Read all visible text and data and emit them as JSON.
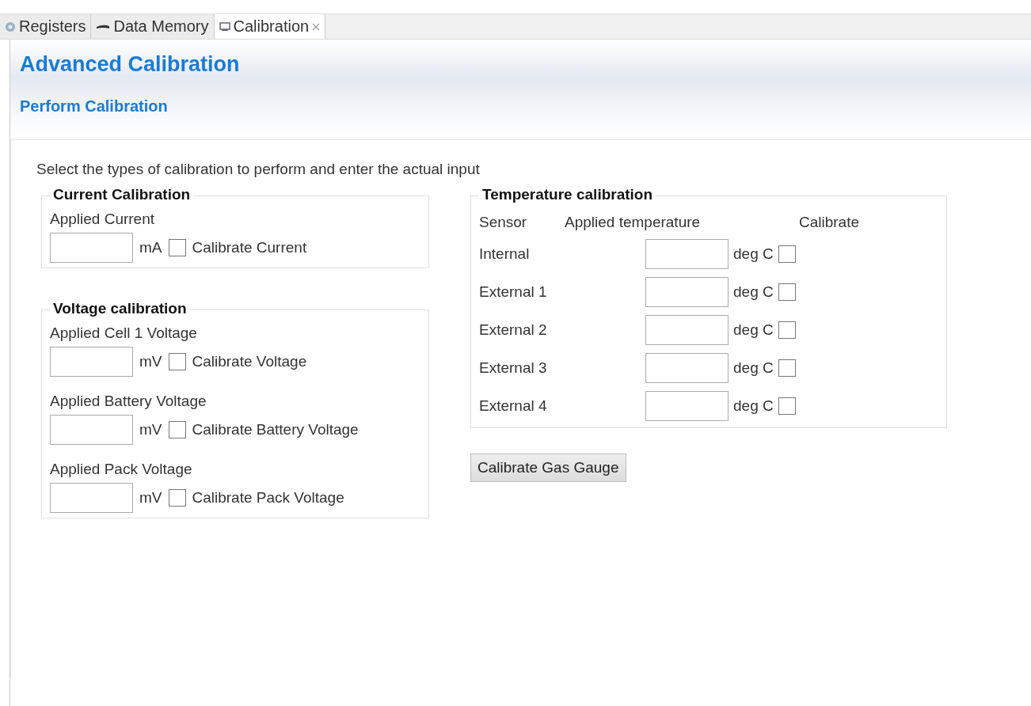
{
  "tabs": [
    {
      "label": "Registers",
      "selected": false
    },
    {
      "label": "Data Memory",
      "selected": false
    },
    {
      "label": "Calibration",
      "selected": true
    }
  ],
  "header": {
    "title": "Advanced Calibration",
    "subtitle": "Perform Calibration"
  },
  "instructions": "Select the types of calibration to perform and enter the actual input",
  "current_calibration": {
    "title": "Current Calibration",
    "rows": [
      {
        "label": "Applied Current",
        "unit": "mA",
        "checkbox_label": "Calibrate Current",
        "checked": false
      }
    ]
  },
  "voltage_calibration": {
    "title": "Voltage calibration",
    "rows": [
      {
        "label": "Applied Cell 1 Voltage",
        "unit": "mV",
        "checkbox_label": "Calibrate Voltage",
        "checked": false
      },
      {
        "label": "Applied Battery Voltage",
        "unit": "mV",
        "checkbox_label": "Calibrate Battery Voltage",
        "checked": false
      },
      {
        "label": "Applied Pack Voltage",
        "unit": "mV",
        "checkbox_label": "Calibrate Pack Voltage",
        "checked": false
      }
    ]
  },
  "temperature_calibration": {
    "title": "Temperature calibration",
    "columns": [
      "Sensor",
      "Applied temperature",
      "Calibrate"
    ],
    "rows": [
      {
        "sensor": "Internal",
        "unit": "deg C",
        "checked": false
      },
      {
        "sensor": "External 1",
        "unit": "deg C",
        "checked": false
      },
      {
        "sensor": "External 2",
        "unit": "deg C",
        "checked": false
      },
      {
        "sensor": "External 3",
        "unit": "deg C",
        "checked": false
      },
      {
        "sensor": "External 4",
        "unit": "deg C",
        "checked": false
      }
    ]
  },
  "button": "Calibrate Gas Gauge"
}
